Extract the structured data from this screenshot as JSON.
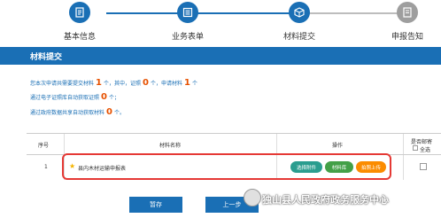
{
  "steps": [
    {
      "label": "基本信息",
      "icon": "document-icon",
      "state": "done"
    },
    {
      "label": "业务表单",
      "icon": "form-icon",
      "state": "done"
    },
    {
      "label": "材料提交",
      "icon": "box-icon",
      "state": "active"
    },
    {
      "label": "申报告知",
      "icon": "notice-icon",
      "state": "pending"
    }
  ],
  "section_title": "材料提交",
  "info": {
    "line1": {
      "pre": "您本次申请共需要提交材料",
      "total": "1",
      "mid1": "个，其中，证照",
      "license": "0",
      "mid2": "个，申请材料",
      "apply": "1",
      "post": "个"
    },
    "line2": {
      "pre": "通过电子证照库自动获取证照",
      "count": "0",
      "post": "个；"
    },
    "line3": {
      "pre": "通过政府数据共享自动获取材料",
      "count": "0",
      "post": "个。"
    }
  },
  "table": {
    "headers": {
      "index": "序号",
      "name": "材料名称",
      "action": "操作",
      "mail": "是否邮寄",
      "select_all": "全选"
    },
    "rows": [
      {
        "index": "1",
        "name": "县内木材运输申报表",
        "buttons": [
          "选择附件",
          "材料库",
          "拍照上传"
        ]
      }
    ]
  },
  "footer": {
    "save": "暂存",
    "prev": "上一步"
  },
  "watermark": "独山县人民政府政务服务中心",
  "colors": {
    "primary": "#1a6fb5",
    "accent_number": "#e65100",
    "highlight": "#e53935",
    "teal": "#2a9d8f",
    "green": "#43a047",
    "orange": "#fb8c00"
  }
}
